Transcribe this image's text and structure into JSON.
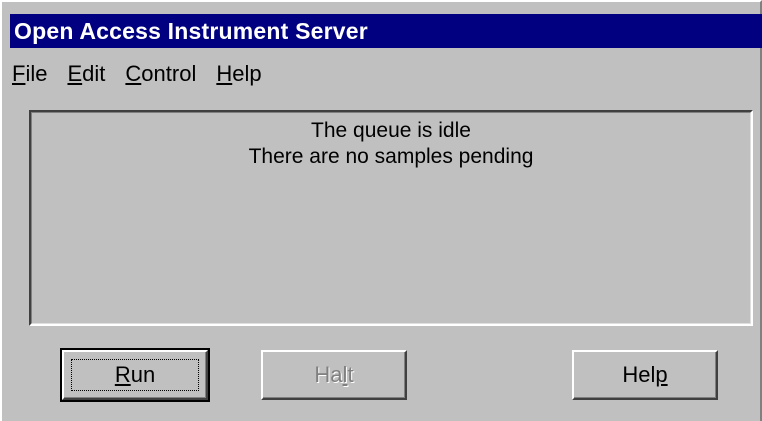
{
  "window": {
    "title": "Open Access Instrument Server"
  },
  "menu": {
    "items": [
      {
        "mnemonic": "F",
        "rest": "ile"
      },
      {
        "mnemonic": "E",
        "rest": "dit"
      },
      {
        "mnemonic": "C",
        "rest": "ontrol"
      },
      {
        "mnemonic": "H",
        "rest": "elp"
      }
    ]
  },
  "queue": {
    "status_line_1": "The queue is idle",
    "status_line_2": "There are no samples pending"
  },
  "buttons": {
    "run": {
      "mnemonic": "R",
      "rest": "un",
      "enabled": true
    },
    "halt": {
      "pre": "Ha",
      "mnemonic": "l",
      "rest": "t",
      "enabled": false
    },
    "help": {
      "pre": "Hel",
      "mnemonic": "p",
      "rest": "",
      "enabled": true
    }
  },
  "colors": {
    "titlebar": "#000080",
    "face": "#c0c0c0",
    "disabled_text": "#808080"
  }
}
